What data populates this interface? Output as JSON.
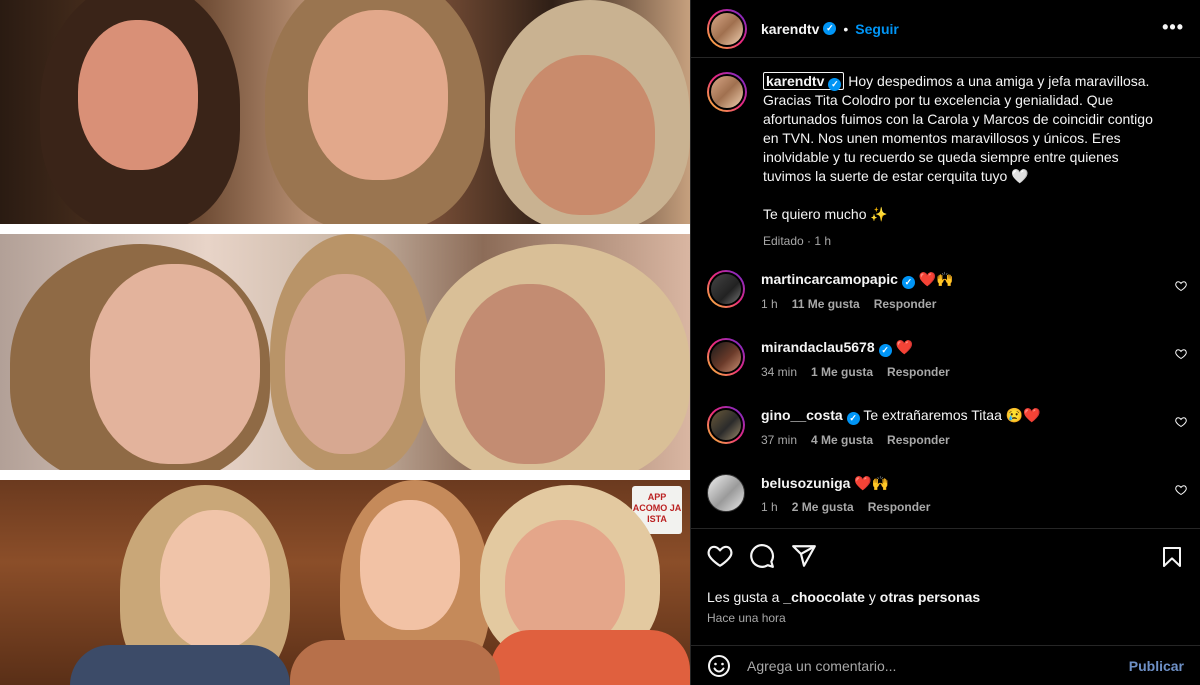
{
  "post": {
    "author": "karendtv",
    "follow_label": "Seguir",
    "more_label": "•••"
  },
  "caption": {
    "author": "karendtv",
    "text": "Hoy despedimos a una amiga y jefa maravillosa. Gracias Tita Colodro por tu excelencia y genialidad. Que afortunados fuimos con la Carola y Marcos de coincidir contigo en TVN. Nos unen momentos maravillosos y únicos. Eres inolvidable y tu recuerdo se queda siempre entre quienes tuvimos la suerte de estar cerquita tuyo 🤍",
    "text2": "Te quiero mucho ✨",
    "meta": "Editado · 1 h"
  },
  "comments": [
    {
      "user": "martincarcamopapic",
      "verified": true,
      "text": "❤️🙌",
      "time": "1 h",
      "likes": "11 Me gusta",
      "reply": "Responder"
    },
    {
      "user": "mirandaclau5678",
      "verified": true,
      "text": "❤️",
      "time": "34 min",
      "likes": "1 Me gusta",
      "reply": "Responder"
    },
    {
      "user": "gino__costa",
      "verified": true,
      "text": "Te extrañaremos Titaa 😢❤️",
      "time": "37 min",
      "likes": "4 Me gusta",
      "reply": "Responder"
    },
    {
      "user": "belusozuniga",
      "verified": false,
      "text": "❤️🙌",
      "time": "1 h",
      "likes": "2 Me gusta",
      "reply": "Responder"
    }
  ],
  "likes": {
    "prefix": "Les gusta a ",
    "user": "_choocolate",
    "mid": " y ",
    "others": "otras personas"
  },
  "time_ago": "Hace una hora",
  "add_comment": {
    "placeholder": "Agrega un comentario...",
    "publish": "Publicar"
  },
  "icons": [
    "heart-icon",
    "comment-icon",
    "share-icon",
    "bookmark-icon",
    "emoji-icon",
    "more-icon"
  ],
  "colors": {
    "accent": "#0095f6",
    "muted": "#a8a8a8",
    "background": "#000000",
    "heart": "#ed4956"
  },
  "photo": {
    "sign_text": "APP ACOMO JA ISTA"
  }
}
